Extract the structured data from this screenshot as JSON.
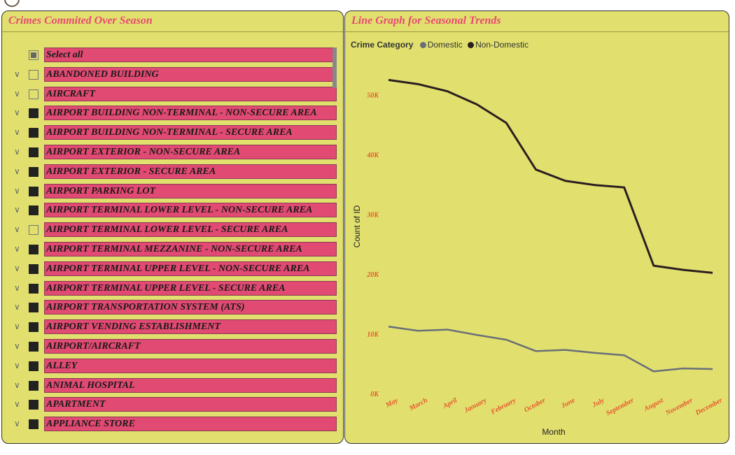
{
  "slicer": {
    "title": "Crimes Commited Over Season",
    "select_all": "Select all",
    "items": [
      {
        "label": "ABANDONED BUILDING",
        "state": "unchecked"
      },
      {
        "label": "AIRCRAFT",
        "state": "unchecked"
      },
      {
        "label": "AIRPORT BUILDING NON-TERMINAL - NON-SECURE AREA",
        "state": "checked"
      },
      {
        "label": "AIRPORT BUILDING NON-TERMINAL - SECURE AREA",
        "state": "checked"
      },
      {
        "label": "AIRPORT EXTERIOR - NON-SECURE AREA",
        "state": "checked"
      },
      {
        "label": "AIRPORT EXTERIOR - SECURE AREA",
        "state": "checked"
      },
      {
        "label": "AIRPORT PARKING LOT",
        "state": "checked"
      },
      {
        "label": "AIRPORT TERMINAL LOWER LEVEL - NON-SECURE AREA",
        "state": "checked"
      },
      {
        "label": "AIRPORT TERMINAL LOWER LEVEL - SECURE AREA",
        "state": "unchecked"
      },
      {
        "label": "AIRPORT TERMINAL MEZZANINE - NON-SECURE AREA",
        "state": "checked"
      },
      {
        "label": "AIRPORT TERMINAL UPPER LEVEL - NON-SECURE AREA",
        "state": "checked"
      },
      {
        "label": "AIRPORT TERMINAL UPPER LEVEL - SECURE AREA",
        "state": "checked"
      },
      {
        "label": "AIRPORT TRANSPORTATION SYSTEM (ATS)",
        "state": "checked"
      },
      {
        "label": "AIRPORT VENDING ESTABLISHMENT",
        "state": "checked"
      },
      {
        "label": "AIRPORT/AIRCRAFT",
        "state": "checked"
      },
      {
        "label": "ALLEY",
        "state": "checked"
      },
      {
        "label": "ANIMAL HOSPITAL",
        "state": "checked"
      },
      {
        "label": "APARTMENT",
        "state": "checked"
      },
      {
        "label": "APPLIANCE STORE",
        "state": "checked"
      }
    ]
  },
  "chart_panel": {
    "title": "Line Graph for Seasonal Trends",
    "legend_title": "Crime Category"
  },
  "chart_data": {
    "type": "line",
    "xlabel": "Month",
    "ylabel": "Count of ID",
    "ylim": [
      0,
      55000
    ],
    "yticks": [
      0,
      10000,
      20000,
      30000,
      40000,
      50000
    ],
    "ytick_labels": [
      "0K",
      "10K",
      "20K",
      "30K",
      "40K",
      "50K"
    ],
    "categories": [
      "May",
      "March",
      "April",
      "January",
      "February",
      "October",
      "June",
      "July",
      "September",
      "August",
      "November",
      "December"
    ],
    "series": [
      {
        "name": "Domestic",
        "color": "#6a6e78",
        "values": [
          11200,
          10500,
          10700,
          9800,
          9000,
          7100,
          7300,
          6800,
          6400,
          3700,
          4200,
          4100
        ]
      },
      {
        "name": "Non-Domestic",
        "color": "#2b1f1f",
        "values": [
          52500,
          51800,
          50600,
          48400,
          45300,
          37500,
          35600,
          34900,
          34500,
          21400,
          20700,
          20200
        ]
      }
    ],
    "grid": false,
    "legend_position": "top-left",
    "tick_color": "#e8562a"
  }
}
